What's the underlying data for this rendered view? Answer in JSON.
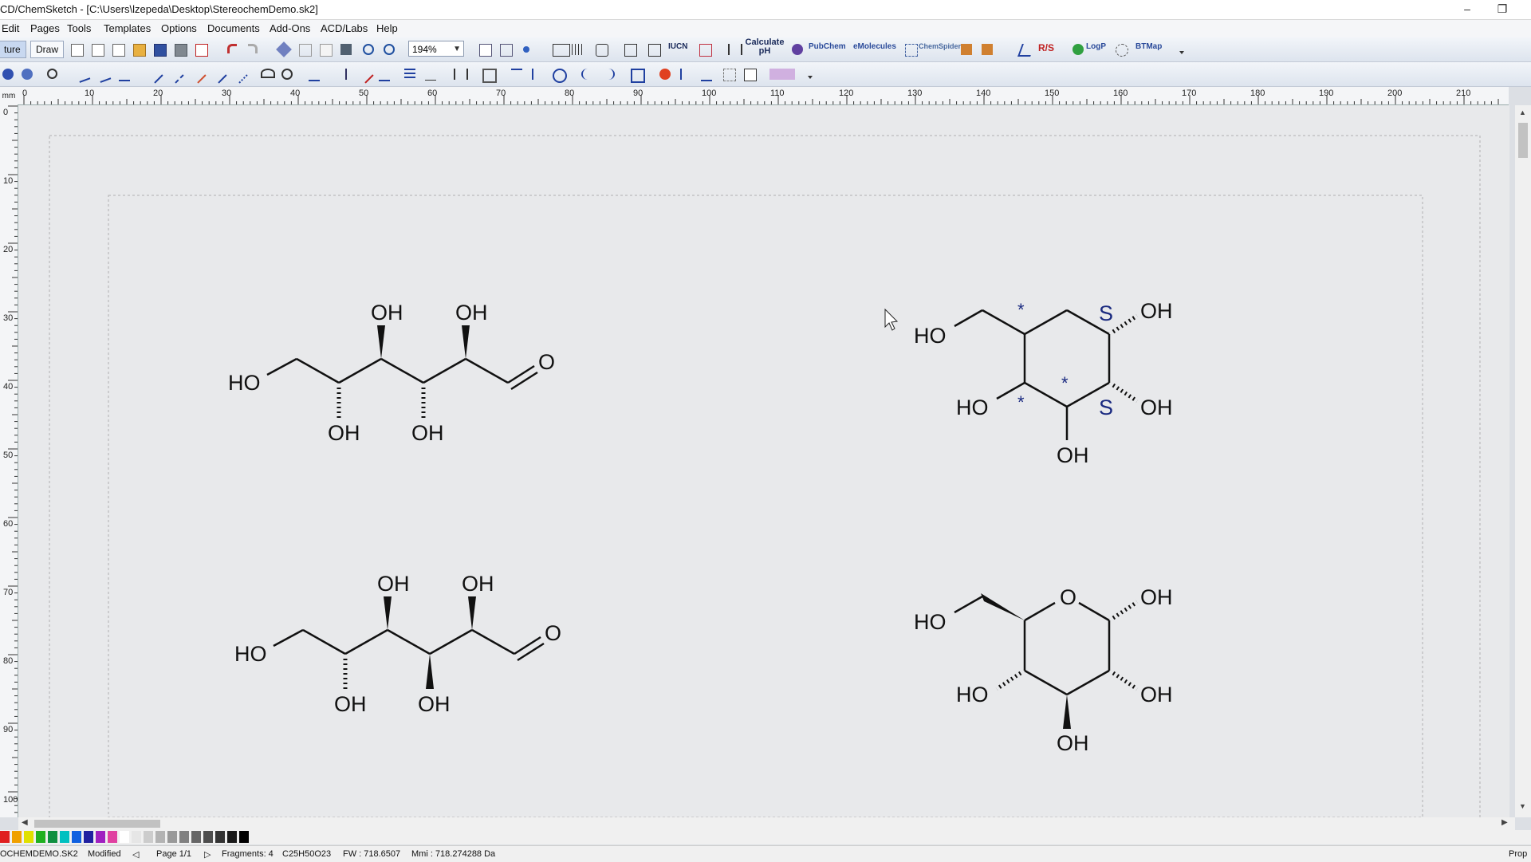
{
  "window": {
    "title": "CD/ChemSketch - [C:\\Users\\lzepeda\\Desktop\\StereochemDemo.sk2]",
    "minimize_glyph": "–",
    "restore_glyph": "❐"
  },
  "menu": [
    "Edit",
    "Pages",
    "Tools",
    "Templates",
    "Options",
    "Documents",
    "Add-Ons",
    "ACD/Labs",
    "Help"
  ],
  "toolbar1": {
    "structure_tab": "ture",
    "draw_tab": "Draw",
    "zoom": "194%",
    "calculate_ph": "Calculate pH",
    "pubchem": "PubChem",
    "emolecules": "eMolecules",
    "chemspider": "ChemSpider",
    "rs": "R/S",
    "logp": "LogP",
    "btmap": "BTMap"
  },
  "ruler": {
    "unit": "mm",
    "h_labels": [
      "0",
      "10",
      "20",
      "30",
      "40",
      "50",
      "60",
      "70",
      "80",
      "90",
      "100",
      "110",
      "120",
      "130",
      "140",
      "150",
      "160",
      "170",
      "180",
      "190",
      "200",
      "210"
    ],
    "v_labels": [
      "0",
      "10",
      "20",
      "30",
      "40",
      "50",
      "60",
      "70",
      "80",
      "90",
      "100"
    ]
  },
  "molecules": {
    "atoms": {
      "oh": "OH",
      "ho": "HO",
      "o": "O",
      "s": "S",
      "star": "*"
    }
  },
  "palette_colors": [
    "#e02020",
    "#f0a000",
    "#e0e000",
    "#20b020",
    "#109040",
    "#00c0c0",
    "#1060e0",
    "#2020a0",
    "#a020c0",
    "#e040a0",
    "#ffffff",
    "#e6e6e6",
    "#cccccc",
    "#b3b3b3",
    "#999999",
    "#808080",
    "#666666",
    "#4d4d4d",
    "#333333",
    "#1a1a1a",
    "#000000"
  ],
  "status": {
    "file": "OCHEMDEMO.SK2",
    "modified": "Modified",
    "page": "Page 1/1",
    "fragments": "Fragments: 4",
    "formula": "C25H50O23",
    "fw": "FW : 718.6507",
    "mass": "Mmi : 718.274288 Da",
    "props": "Prop"
  }
}
